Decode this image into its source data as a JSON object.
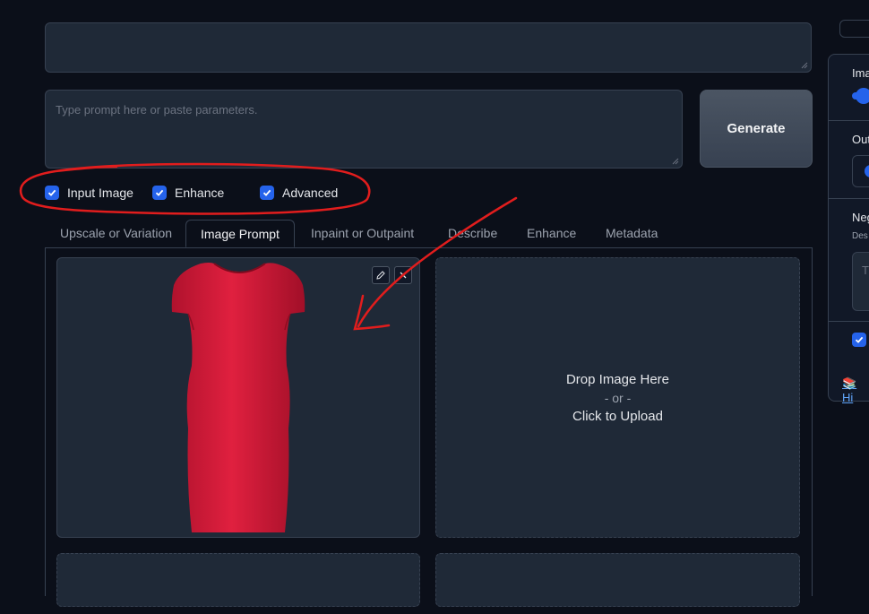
{
  "prompt": {
    "placeholder": "Type prompt here or paste parameters."
  },
  "generate_label": "Generate",
  "checkboxes": [
    {
      "label": "Input Image",
      "checked": true
    },
    {
      "label": "Enhance",
      "checked": true
    },
    {
      "label": "Advanced",
      "checked": true
    }
  ],
  "tabs": [
    {
      "label": "Upscale or Variation"
    },
    {
      "label": "Image Prompt",
      "active": true
    },
    {
      "label": "Inpaint or Outpaint"
    },
    {
      "label": "Describe"
    },
    {
      "label": "Enhance"
    },
    {
      "label": "Metadata"
    }
  ],
  "upload": {
    "line1": "Drop Image Here",
    "line2": "- or -",
    "line3": "Click to Upload"
  },
  "right_panel": {
    "image_label_partial": "Ima",
    "output_label_partial": "Out",
    "negative_label_partial": "Neg",
    "negative_desc_partial": "Des",
    "negative_placeholder_partial": "T",
    "help_link_partial": "Hi"
  },
  "colors": {
    "accent": "#2563eb",
    "annotation": "#e11d1d",
    "dress": "#d81b3a",
    "background": "#0b0f19",
    "panel": "#1f2937"
  },
  "icons": [
    "checkmark-icon",
    "pencil-icon",
    "close-icon",
    "resize-handle-icon",
    "book-icon"
  ]
}
